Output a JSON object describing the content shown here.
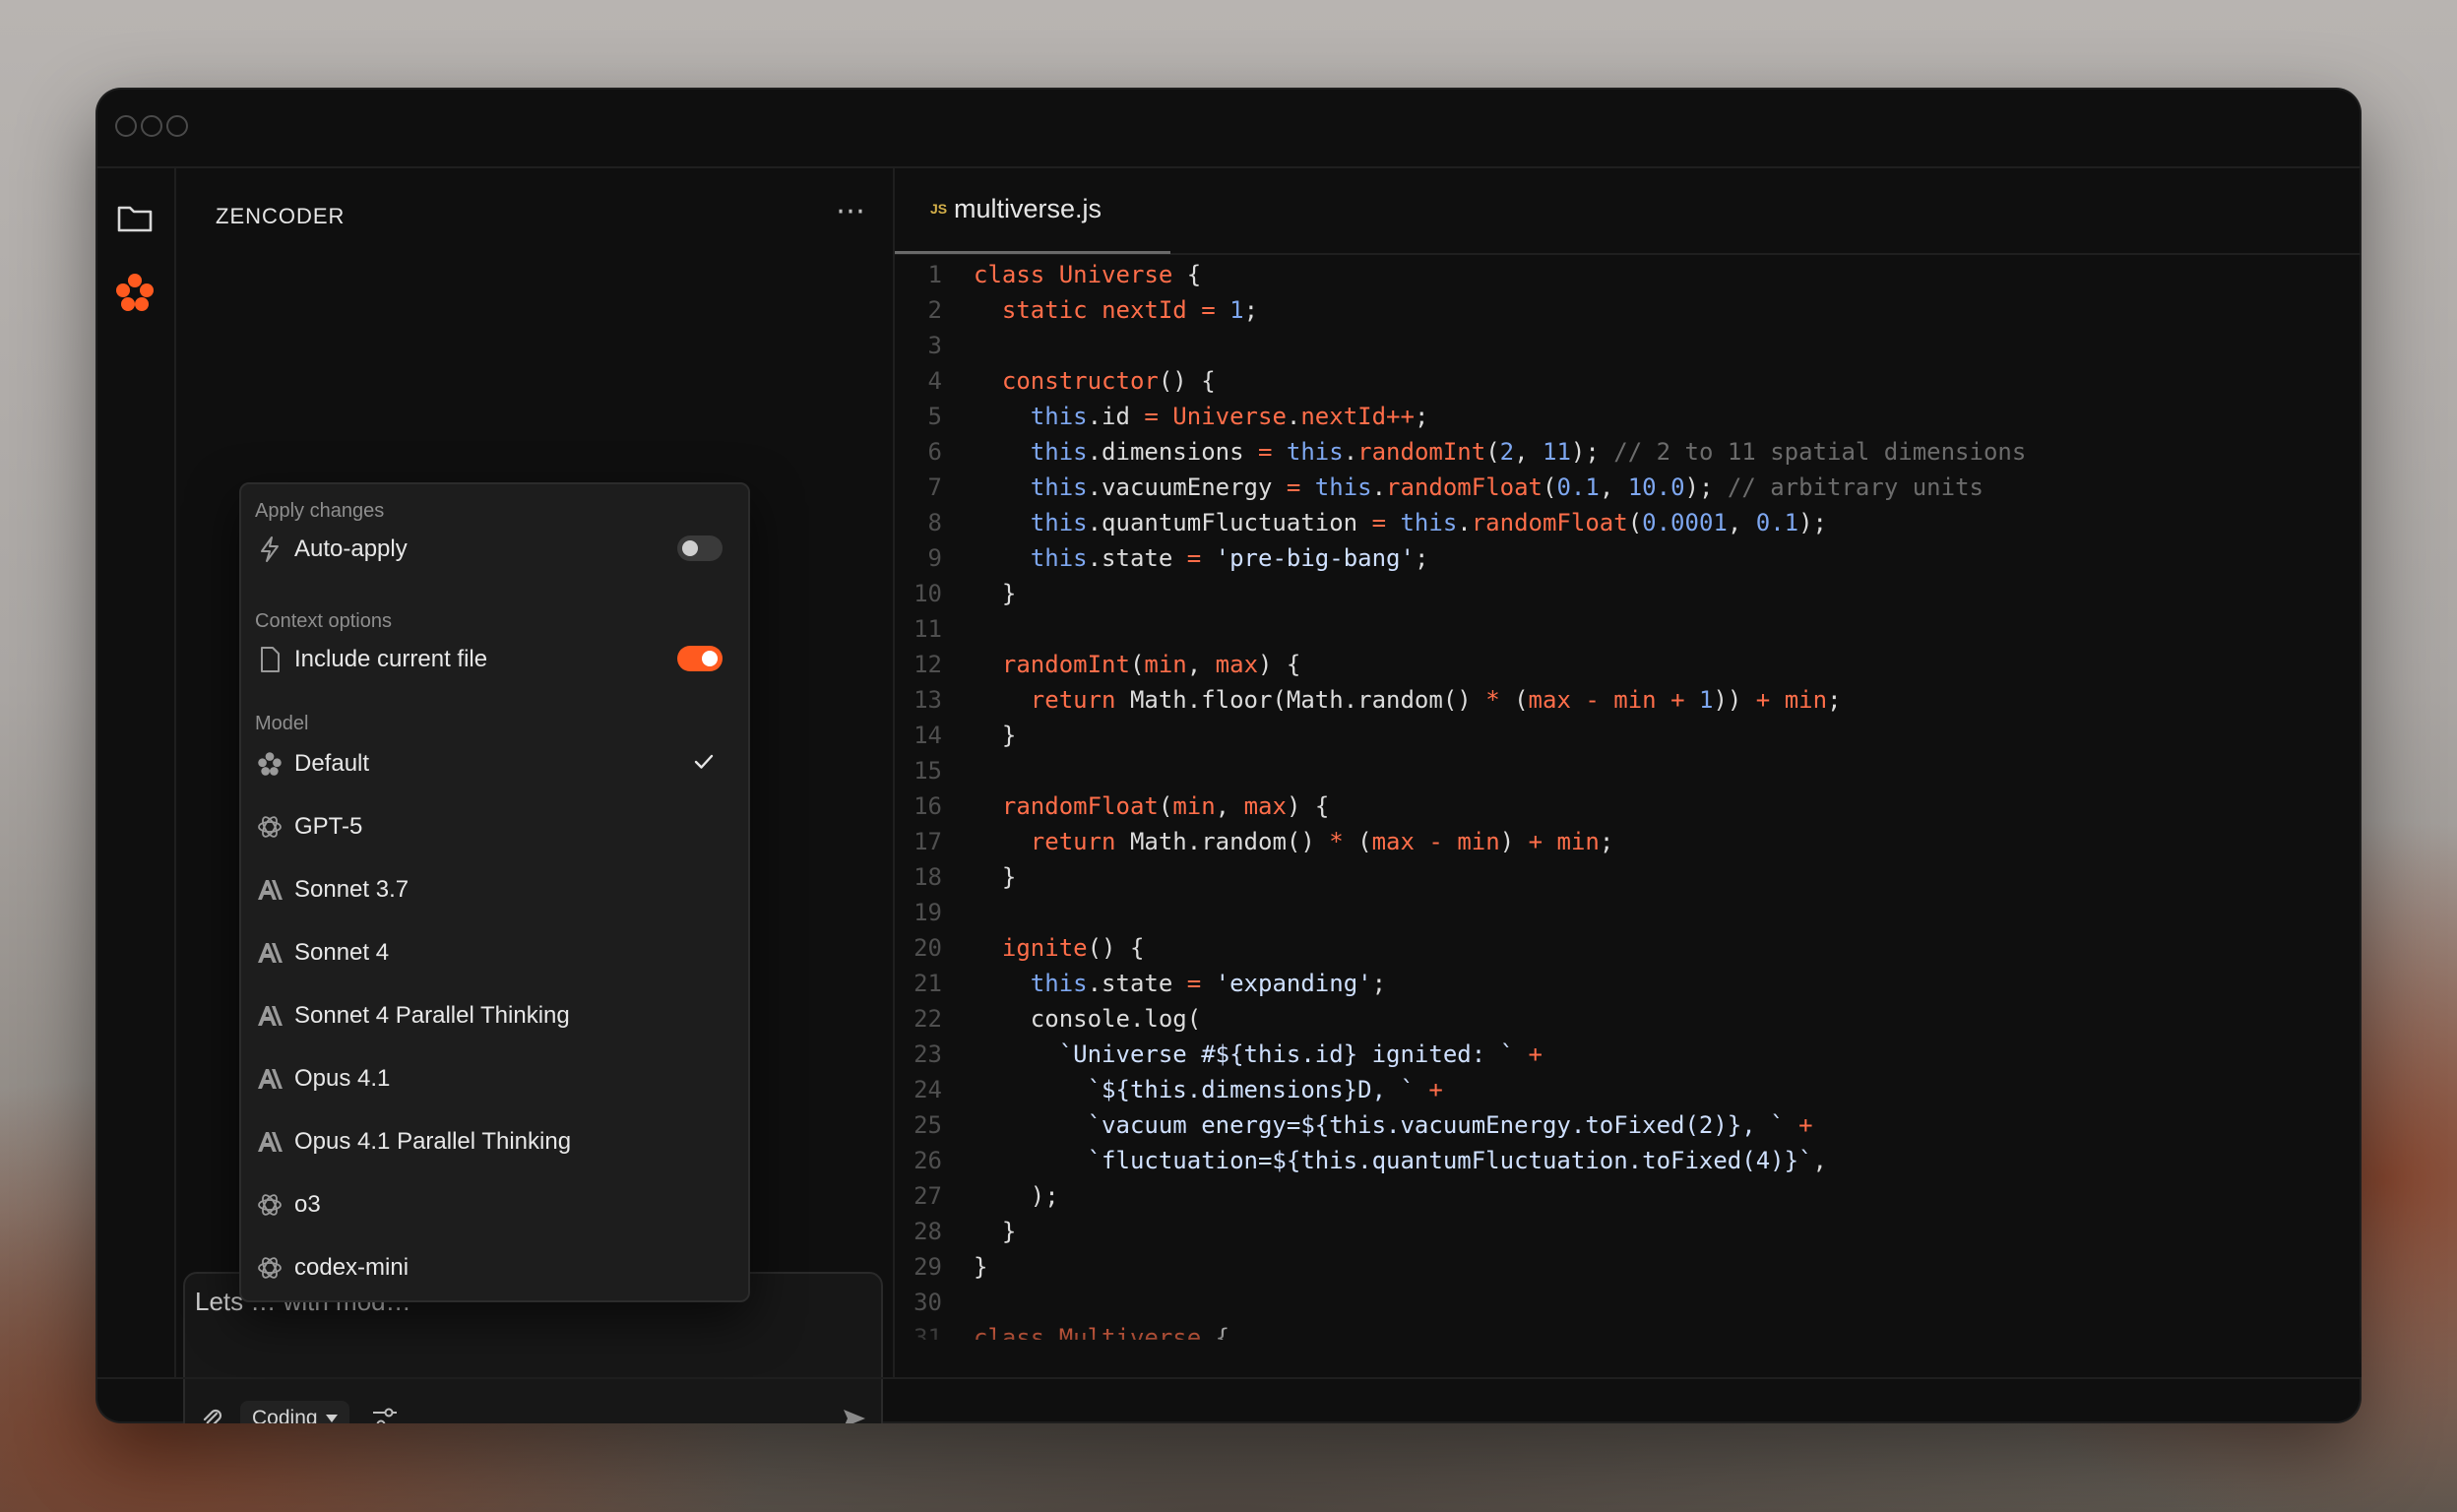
{
  "sidebar": {
    "title": "ZENCODER",
    "more_label": "⋯"
  },
  "chat": {
    "input_text": "Lets … with mod…",
    "mode": "Coding"
  },
  "menu": {
    "apply_section": "Apply changes",
    "auto_apply": {
      "label": "Auto-apply",
      "enabled": false
    },
    "context_section": "Context options",
    "include_file": {
      "label": "Include current file",
      "enabled": true
    },
    "model_section": "Model",
    "models": [
      {
        "label": "Default",
        "icon": "zencoder-icon",
        "selected": true
      },
      {
        "label": "GPT-5",
        "icon": "openai-icon"
      },
      {
        "label": "Sonnet 3.7",
        "icon": "anthropic-icon"
      },
      {
        "label": "Sonnet 4",
        "icon": "anthropic-icon"
      },
      {
        "label": "Sonnet 4 Parallel Thinking",
        "icon": "anthropic-icon"
      },
      {
        "label": "Opus 4.1",
        "icon": "anthropic-icon"
      },
      {
        "label": "Opus 4.1 Parallel Thinking",
        "icon": "anthropic-icon"
      },
      {
        "label": "o3",
        "icon": "openai-icon"
      },
      {
        "label": "codex-mini",
        "icon": "openai-icon"
      }
    ]
  },
  "editor": {
    "tab_badge": "JS",
    "tab_name": "multiverse.js",
    "lines": [
      "class Universe {",
      "  static nextId = 1;",
      "",
      "  constructor() {",
      "    this.id = Universe.nextId++;",
      "    this.dimensions = this.randomInt(2, 11); // 2 to 11 spatial dimensions",
      "    this.vacuumEnergy = this.randomFloat(0.1, 10.0); // arbitrary units",
      "    this.quantumFluctuation = this.randomFloat(0.0001, 0.1);",
      "    this.state = 'pre-big-bang';",
      "  }",
      "",
      "  randomInt(min, max) {",
      "    return Math.floor(Math.random() * (max - min + 1)) + min;",
      "  }",
      "",
      "  randomFloat(min, max) {",
      "    return Math.random() * (max - min) + min;",
      "  }",
      "",
      "  ignite() {",
      "    this.state = 'expanding';",
      "    console.log(",
      "      `Universe #${this.id} ignited: ` +",
      "        `${this.dimensions}D, ` +",
      "        `vacuum energy=${this.vacuumEnergy.toFixed(2)}, ` +",
      "        `fluctuation=${this.quantumFluctuation.toFixed(4)}`,",
      "    );",
      "  }",
      "}",
      "",
      "class Multiverse {"
    ]
  },
  "colors": {
    "accent": "#ff5a1f",
    "keyword": "#ff6e4a",
    "number": "#7ea7f0",
    "comment": "#6c6c6c"
  }
}
